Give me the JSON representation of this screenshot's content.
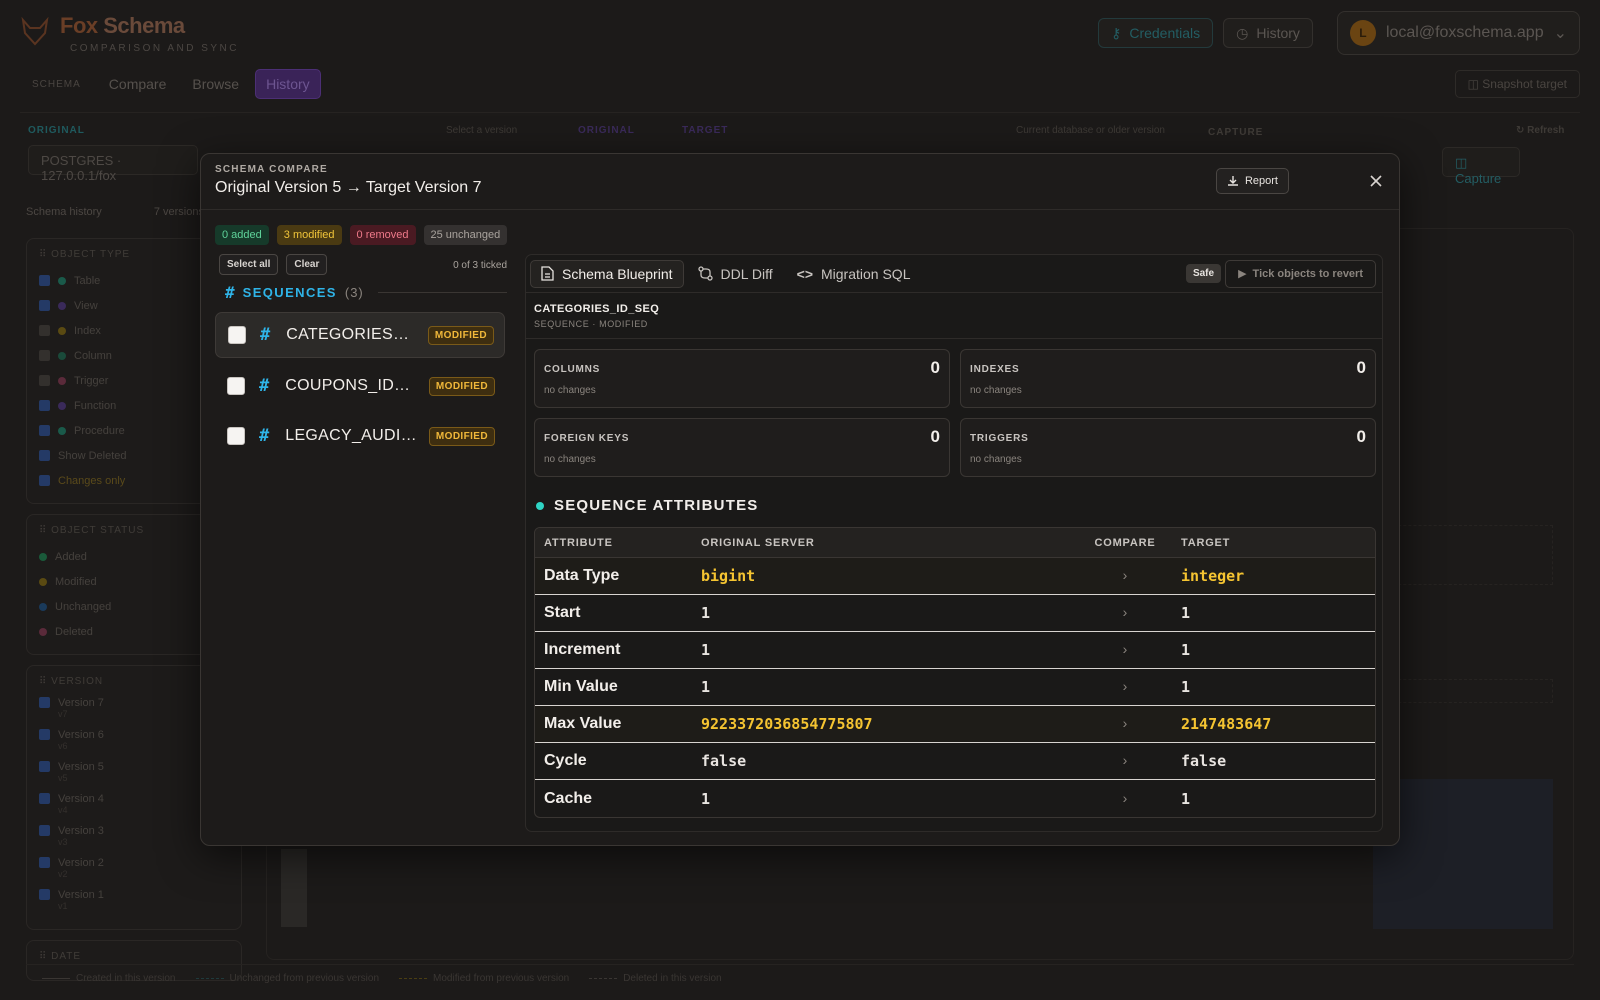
{
  "app": {
    "brand_prefix": "Fox",
    "brand_suffix": "Schema",
    "subtitle": "COMPARISON AND SYNC",
    "credentials_label": "Credentials",
    "history_label": "History",
    "user_initial": "L",
    "user_email": "local@foxschema.app"
  },
  "nav": {
    "section_label": "SCHEMA",
    "tabs": [
      "Compare",
      "Browse",
      "History"
    ],
    "active_tab": "History",
    "snapshot_label": "Snapshot target"
  },
  "selector": {
    "original_label": "ORIGINAL",
    "original_hint": "Select a version",
    "original_value": "POSTGRES · 127.0.0.1/fox",
    "mid_label": "ORIGINAL",
    "target_label": "TARGET",
    "target_hint": "Current database or older version",
    "capture_label": "CAPTURE",
    "refresh_label": "Refresh",
    "capture_button": "Capture"
  },
  "history_panel": {
    "title": "Schema history",
    "count": "7 versions",
    "object_type_title": "OBJECT TYPE",
    "object_types": [
      "Table",
      "View",
      "Index",
      "Column",
      "Trigger",
      "Function",
      "Procedure"
    ],
    "show_deleted": "Show Deleted",
    "changes_only": "Changes only",
    "object_status_title": "OBJECT STATUS",
    "statuses": [
      "Added",
      "Modified",
      "Unchanged",
      "Deleted"
    ],
    "version_title": "VERSION",
    "versions": [
      {
        "label": "Version 7",
        "tag": "v7"
      },
      {
        "label": "Version 6",
        "tag": "v6"
      },
      {
        "label": "Version 5",
        "tag": "v5"
      },
      {
        "label": "Version 4",
        "tag": "v4"
      },
      {
        "label": "Version 3",
        "tag": "v3"
      },
      {
        "label": "Version 2",
        "tag": "v2"
      },
      {
        "label": "Version 1",
        "tag": "v1"
      }
    ],
    "date_title": "DATE"
  },
  "legend": [
    "Created in this version",
    "Unchanged from previous version",
    "Modified from previous version",
    "Deleted in this version"
  ],
  "modal": {
    "kicker": "SCHEMA COMPARE",
    "title": "Original Version 5 → Target Version 7",
    "report_label": "Report",
    "summary": {
      "added": "0 added",
      "modified": "3 modified",
      "removed": "0 removed",
      "unchanged": "25 unchanged"
    },
    "select_all": "Select all",
    "clear": "Clear",
    "ticked": "0 of 3 ticked",
    "group": {
      "title": "SEQUENCES",
      "count": "(3)"
    },
    "objects": [
      {
        "name": "CATEGORIES_ID...",
        "status": "MODIFIED"
      },
      {
        "name": "COUPONS_ID_S...",
        "status": "MODIFIED"
      },
      {
        "name": "LEGACY_AUDIT...",
        "status": "MODIFIED"
      }
    ],
    "tabs": [
      "Schema Blueprint",
      "DDL Diff",
      "Migration SQL"
    ],
    "safe_label": "Safe",
    "revert_label": "Tick objects to revert",
    "selected": {
      "name": "CATEGORIES_ID_SEQ",
      "sub": "SEQUENCE · MODIFIED"
    },
    "stats": [
      {
        "label": "COLUMNS",
        "value": "0",
        "desc": "no changes"
      },
      {
        "label": "INDEXES",
        "value": "0",
        "desc": "no changes"
      },
      {
        "label": "FOREIGN KEYS",
        "value": "0",
        "desc": "no changes"
      },
      {
        "label": "TRIGGERS",
        "value": "0",
        "desc": "no changes"
      }
    ],
    "attributes_title": "SEQUENCE ATTRIBUTES",
    "table_headers": [
      "ATTRIBUTE",
      "ORIGINAL SERVER",
      "COMPARE",
      "TARGET"
    ],
    "rows": [
      {
        "attr": "Data Type",
        "original": "bigint",
        "target": "integer",
        "diff": true
      },
      {
        "attr": "Start",
        "original": "1",
        "target": "1",
        "diff": false
      },
      {
        "attr": "Increment",
        "original": "1",
        "target": "1",
        "diff": false
      },
      {
        "attr": "Min Value",
        "original": "1",
        "target": "1",
        "diff": false
      },
      {
        "attr": "Max Value",
        "original": "9223372036854775807",
        "target": "2147483647",
        "diff": true
      },
      {
        "attr": "Cycle",
        "original": "false",
        "target": "false",
        "diff": false
      },
      {
        "attr": "Cache",
        "original": "1",
        "target": "1",
        "diff": false
      }
    ]
  },
  "colors": {
    "added": "#5fd39a",
    "modified": "#f0c43a",
    "removed": "#ef7a8a",
    "sequence_accent": "#2fb4e8",
    "attr_dot": "#2fd4c4"
  }
}
